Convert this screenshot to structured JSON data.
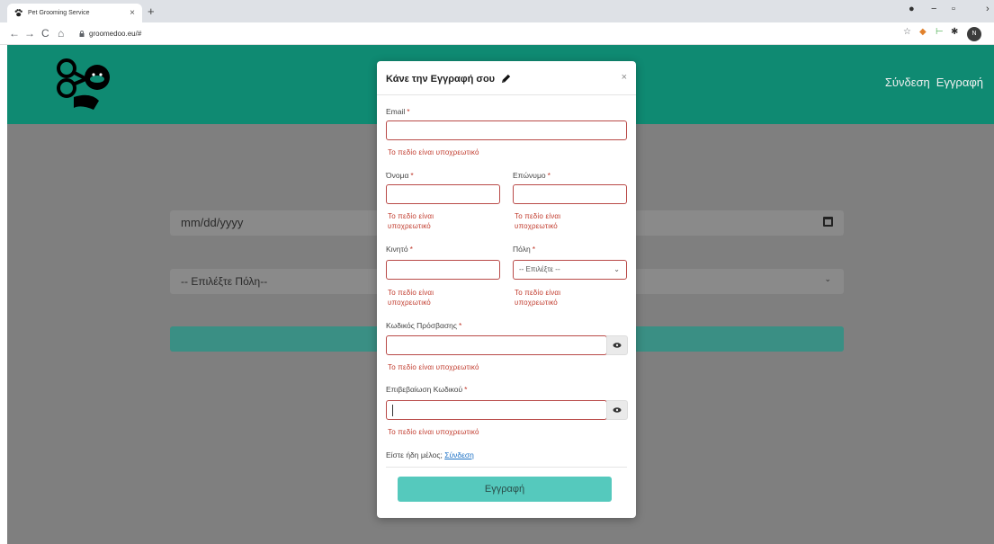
{
  "browser": {
    "tab_title": "Pet Grooming Service",
    "tab_close": "×",
    "new_tab": "+",
    "url": "groomedoo.eu/#",
    "back": "←",
    "forward": "→",
    "reload": "C",
    "home": "⌂",
    "profile_initial": "N",
    "win_min": "−",
    "win_max": "▫"
  },
  "site": {
    "nav": [
      "Σύνδεση",
      "Εγγραφή"
    ],
    "bg_date_placeholder": "mm/dd/yyyy",
    "bg_city_placeholder": "-- Επιλέξτε Πόλη--"
  },
  "modal": {
    "title": "Κάνε την Εγγραφή σου",
    "close": "×",
    "required_mark": "*",
    "fields": {
      "email": "Email",
      "first_name": "Όνομα",
      "last_name": "Επώνυμο",
      "mobile": "Κινητό",
      "city": "Πόλη",
      "password": "Κωδικός Πρόσβασης",
      "confirm_password": "Επιβεβαίωση Κωδικού"
    },
    "city_select_value": "-- Επιλέξτε --",
    "error_full": "Το πεδίο είναι υποχρεωτικό",
    "error_line1": "Το πεδίο είναι",
    "error_line2": "υποχρεωτικό",
    "member_text": "Είστε ήδη μέλος;",
    "member_link": "Σύνδεση",
    "submit_label": "Εγγραφή"
  },
  "colors": {
    "header": "#0f8a72",
    "error": "#c0392b",
    "submit": "#55c9bd",
    "overlay": "#7f7f7f"
  }
}
